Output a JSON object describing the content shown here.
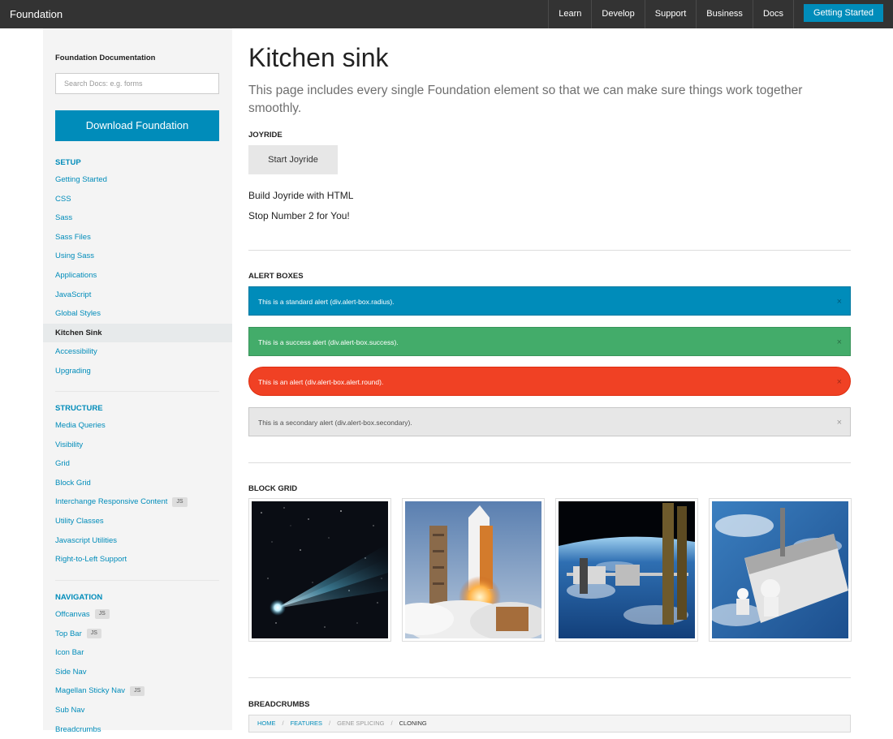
{
  "header": {
    "brand": "Foundation",
    "nav": [
      "Learn",
      "Develop",
      "Support",
      "Business",
      "Docs"
    ],
    "cta": "Getting Started"
  },
  "sidebar": {
    "title": "Foundation Documentation",
    "search_placeholder": "Search Docs: e.g. forms",
    "download_label": "Download Foundation",
    "sections": [
      {
        "heading": "SETUP",
        "items": [
          {
            "label": "Getting Started"
          },
          {
            "label": "CSS"
          },
          {
            "label": "Sass"
          },
          {
            "label": "Sass Files"
          },
          {
            "label": "Using Sass"
          },
          {
            "label": "Applications"
          },
          {
            "label": "JavaScript"
          },
          {
            "label": "Global Styles"
          },
          {
            "label": "Kitchen Sink",
            "active": true
          },
          {
            "label": "Accessibility"
          },
          {
            "label": "Upgrading"
          }
        ]
      },
      {
        "heading": "STRUCTURE",
        "items": [
          {
            "label": "Media Queries"
          },
          {
            "label": "Visibility"
          },
          {
            "label": "Grid"
          },
          {
            "label": "Block Grid"
          },
          {
            "label": "Interchange Responsive Content",
            "badge": "JS"
          },
          {
            "label": "Utility Classes"
          },
          {
            "label": "Javascript Utilities"
          },
          {
            "label": "Right-to-Left Support"
          }
        ]
      },
      {
        "heading": "NAVIGATION",
        "items": [
          {
            "label": "Offcanvas",
            "badge": "JS"
          },
          {
            "label": "Top Bar",
            "badge": "JS"
          },
          {
            "label": "Icon Bar"
          },
          {
            "label": "Side Nav"
          },
          {
            "label": "Magellan Sticky Nav",
            "badge": "JS"
          },
          {
            "label": "Sub Nav"
          },
          {
            "label": "Breadcrumbs"
          }
        ]
      }
    ]
  },
  "main": {
    "title": "Kitchen sink",
    "lead": "This page includes every single Foundation element so that we can make sure things work together smoothly.",
    "joyride": {
      "heading": "JOYRIDE",
      "button": "Start Joyride",
      "line1": "Build Joyride with HTML",
      "line2": "Stop Number 2 for You!"
    },
    "alerts": {
      "heading": "ALERT BOXES",
      "items": [
        {
          "text": "This is a standard alert (div.alert-box.radius).",
          "kind": "standard"
        },
        {
          "text": "This is a success alert (div.alert-box.success).",
          "kind": "success"
        },
        {
          "text": "This is an alert (div.alert-box.alert.round).",
          "kind": "round"
        },
        {
          "text": "This is a secondary alert (div.alert-box.secondary).",
          "kind": "secondary"
        }
      ],
      "close_glyph": "×"
    },
    "block_grid": {
      "heading": "BLOCK GRID",
      "images": [
        "comet",
        "shuttle-launch",
        "space-station",
        "spacewalk"
      ]
    },
    "breadcrumbs": {
      "heading": "BREADCRUMBS",
      "items": [
        {
          "label": "HOME",
          "state": "link"
        },
        {
          "label": "FEATURES",
          "state": "link"
        },
        {
          "label": "GENE SPLICING",
          "state": "unavailable"
        },
        {
          "label": "CLONING",
          "state": "current"
        }
      ],
      "separator": "/"
    }
  }
}
